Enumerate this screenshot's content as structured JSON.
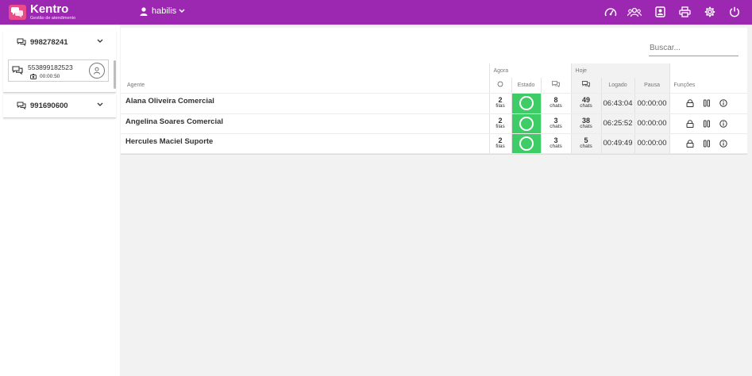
{
  "app": {
    "name": "Kentro",
    "subtitle": "Gestão de atendimento"
  },
  "header": {
    "user": "habilis",
    "icons": [
      "dashboard-icon",
      "users-icon",
      "contact-icon",
      "print-icon",
      "settings-icon",
      "power-icon"
    ]
  },
  "sidebar": {
    "groups": [
      {
        "number": "998278241",
        "chats": [
          {
            "number": "553899182523",
            "timer": "00:00:50"
          }
        ]
      },
      {
        "number": "991690600",
        "chats": []
      }
    ]
  },
  "main": {
    "search_placeholder": "Buscar...",
    "table": {
      "group_headers": {
        "now": "Agora",
        "today": "Hoje"
      },
      "columns": {
        "agent": "Agente",
        "state": "Estado",
        "logged": "Logado",
        "pause": "Pausa",
        "functions": "Funções"
      },
      "unit_queues": "filas",
      "unit_chats": "chats",
      "rows": [
        {
          "agent": "Alana Oliveira Comercial",
          "queues": "2",
          "chats_now": "8",
          "chats_today": "49",
          "logged": "06:43:04",
          "pause": "00:00:00"
        },
        {
          "agent": "Angelina Soares Comercial",
          "queues": "2",
          "chats_now": "3",
          "chats_today": "38",
          "logged": "06:25:52",
          "pause": "00:00:00"
        },
        {
          "agent": "Hercules Maciel Suporte",
          "queues": "2",
          "chats_now": "3",
          "chats_today": "5",
          "logged": "00:49:49",
          "pause": "00:00:00"
        }
      ]
    }
  },
  "colors": {
    "header": "#9c27b0",
    "logo": "#ea4c89",
    "state_online": "#3ecc66"
  }
}
